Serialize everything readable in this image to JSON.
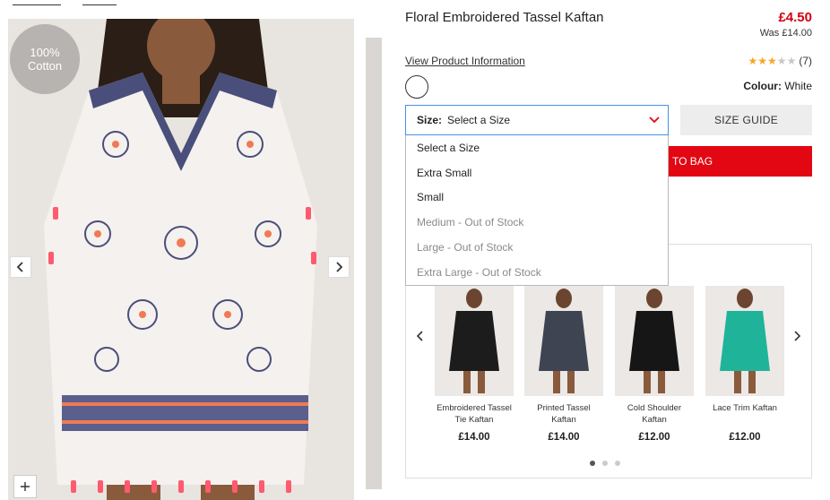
{
  "product": {
    "title": "Floral Embroidered Tassel Kaftan",
    "price": "£4.50",
    "was_price": "Was £14.00",
    "view_info": "View Product Information",
    "rating_count": "(7)",
    "rating_value": 3,
    "rating_max": 5,
    "colour_label": "Colour:",
    "colour_value": "White",
    "badge_line1": "100%",
    "badge_line2": "Cotton"
  },
  "size": {
    "label": "Size:",
    "value": "Select a Size",
    "guide": "SIZE GUIDE",
    "options": [
      {
        "label": "Select a Size",
        "available": true
      },
      {
        "label": "Extra Small",
        "available": true
      },
      {
        "label": "Small",
        "available": true
      },
      {
        "label": "Medium - Out of Stock",
        "available": false
      },
      {
        "label": "Large - Out of Stock",
        "available": false
      },
      {
        "label": "Extra Large - Out of Stock",
        "available": false
      }
    ]
  },
  "add_to_bag": "TO BAG",
  "recommendations": [
    {
      "name": "Embroidered Tassel Tie Kaftan",
      "price": "£14.00",
      "color": "#1c1c1c"
    },
    {
      "name": "Printed Tassel Kaftan",
      "price": "£14.00",
      "color": "#3e4452"
    },
    {
      "name": "Cold Shoulder Kaftan",
      "price": "£12.00",
      "color": "#161616"
    },
    {
      "name": "Lace Trim Kaftan",
      "price": "£12.00",
      "color": "#1fb39a"
    }
  ],
  "carousel": {
    "pages": 3,
    "active": 0
  },
  "colors": {
    "accent": "#e30613",
    "price": "#d5000f",
    "star": "#f5a623",
    "focus": "#4a90e2"
  },
  "icons": {
    "prev": "chevron-left-icon",
    "next": "chevron-right-icon",
    "zoom": "plus-icon",
    "select": "chevron-down-icon"
  }
}
